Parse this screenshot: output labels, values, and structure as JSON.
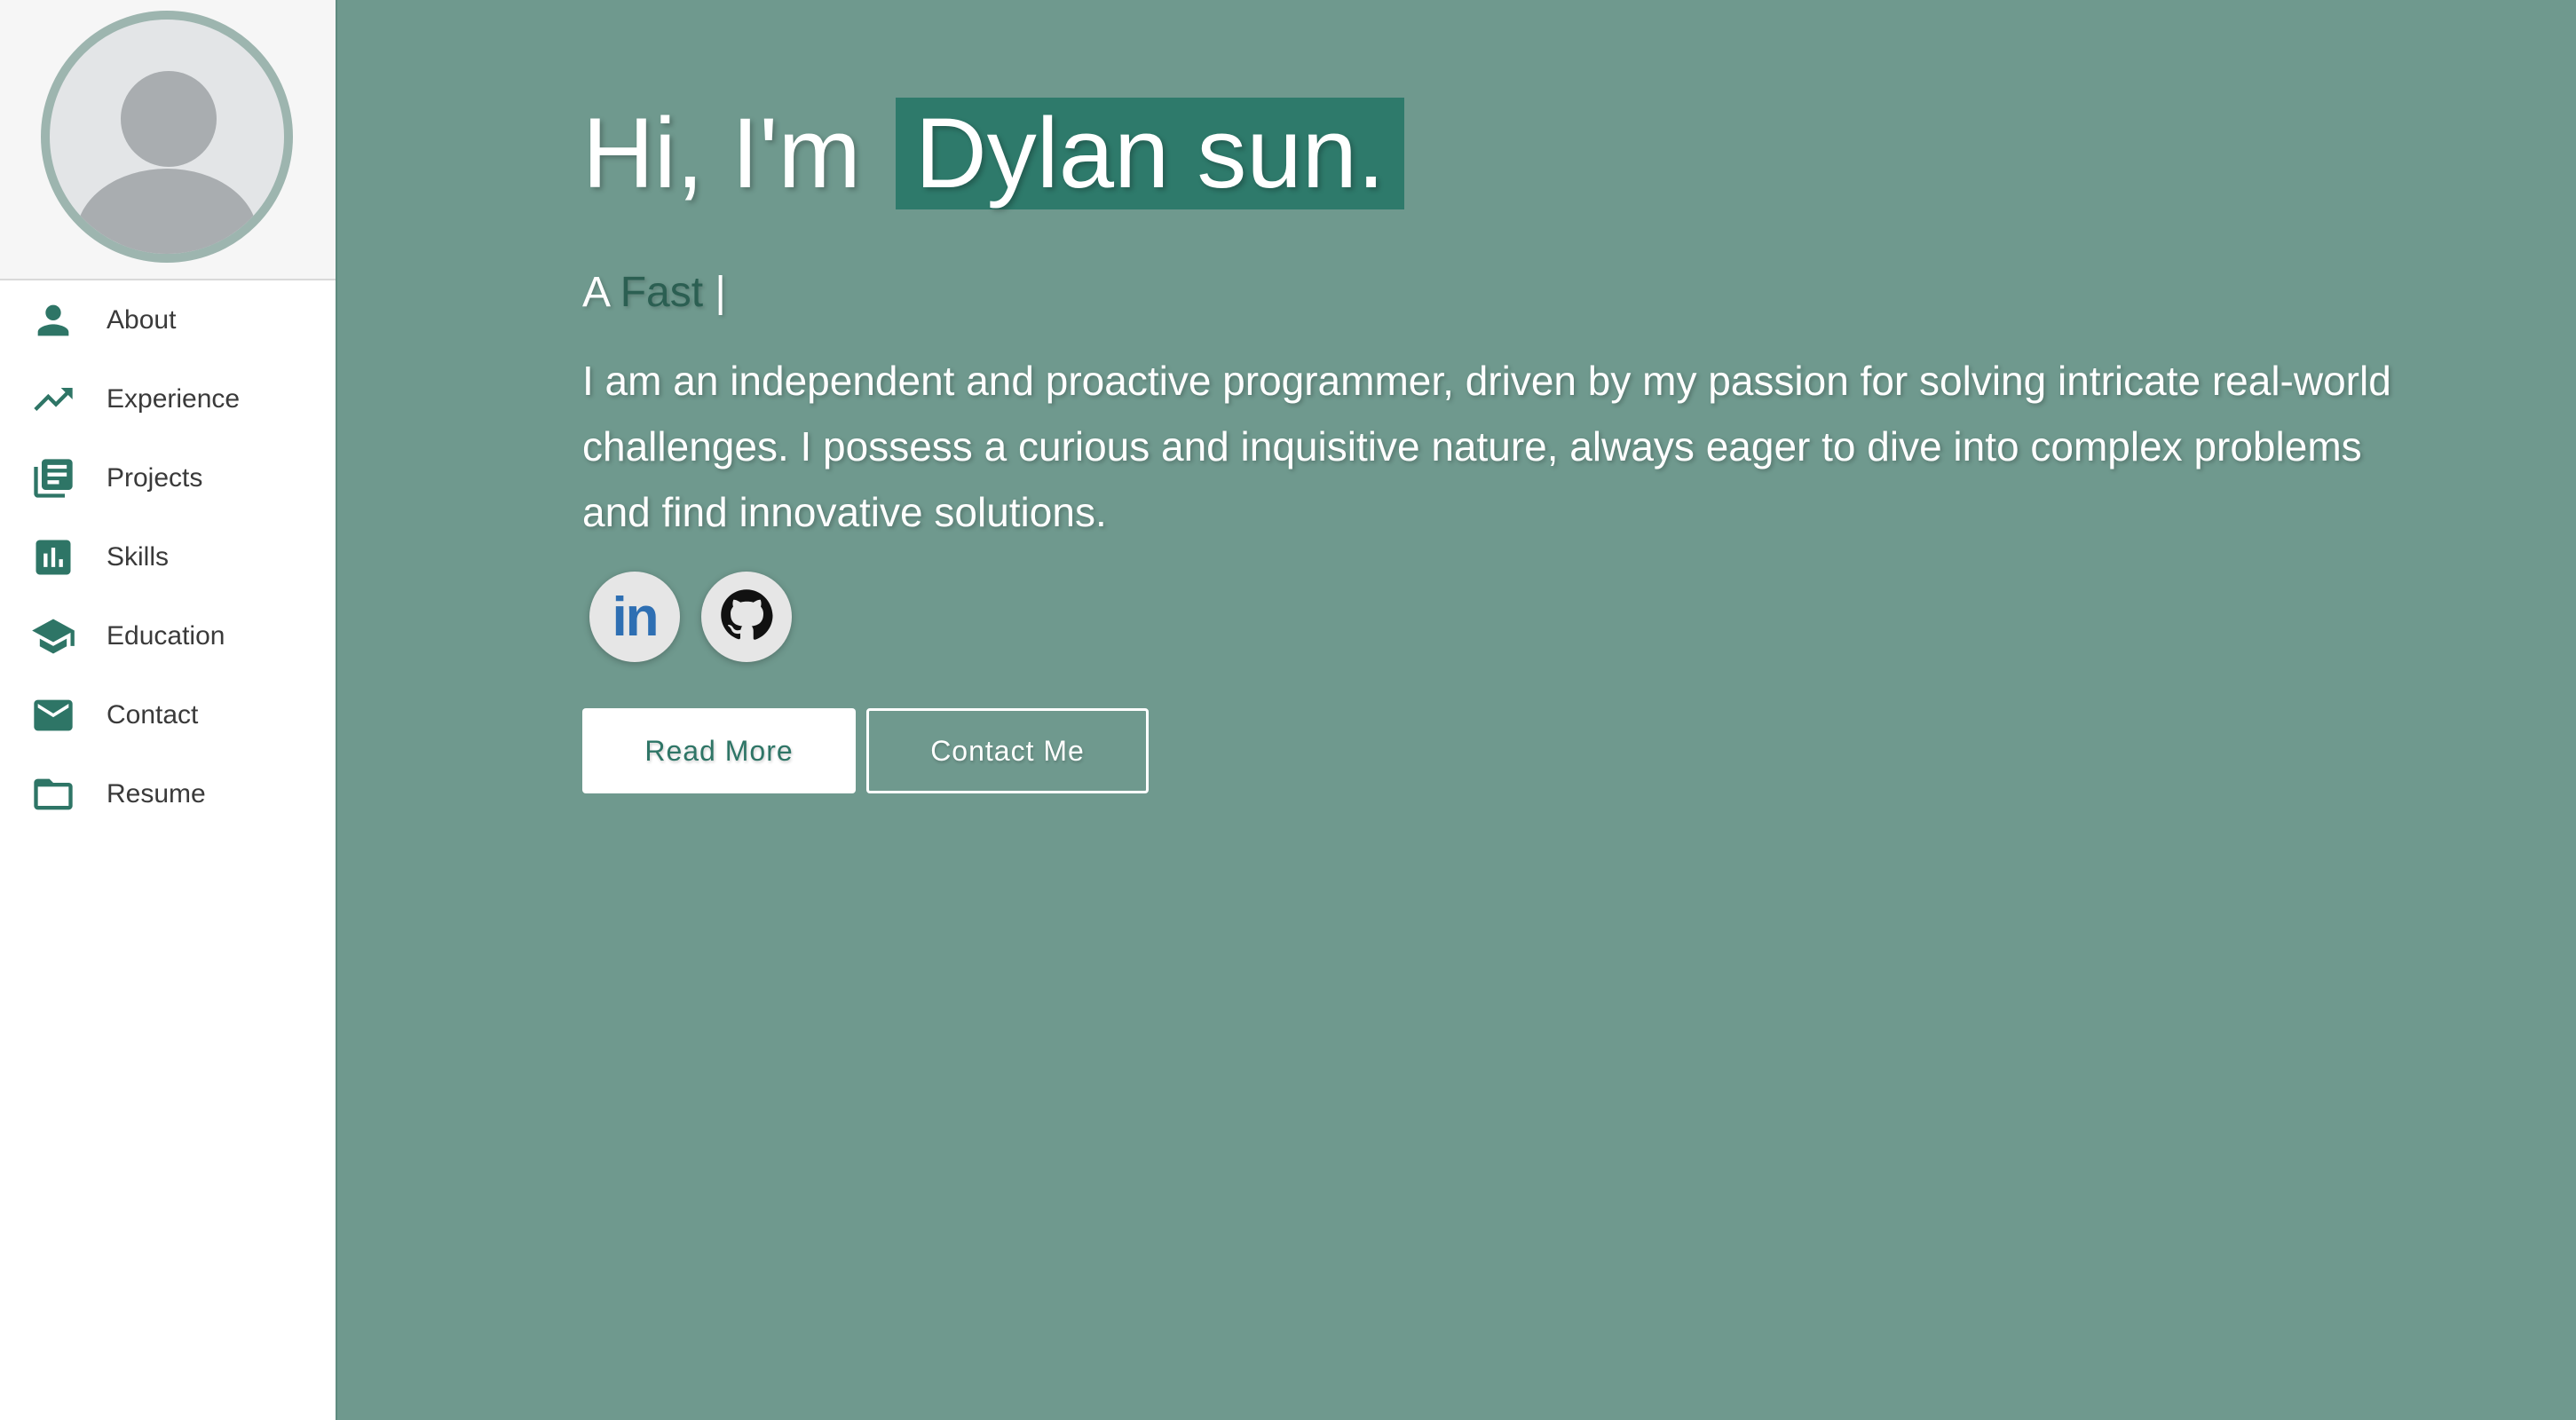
{
  "sidebar": {
    "items": [
      {
        "label": "About",
        "icon": "person-icon"
      },
      {
        "label": "Experience",
        "icon": "trending-up-icon"
      },
      {
        "label": "Projects",
        "icon": "library-books-icon"
      },
      {
        "label": "Skills",
        "icon": "bar-chart-icon"
      },
      {
        "label": "Education",
        "icon": "school-icon"
      },
      {
        "label": "Contact",
        "icon": "mail-icon"
      },
      {
        "label": "Resume",
        "icon": "folder-icon"
      }
    ]
  },
  "hero": {
    "greeting_prefix": "Hi, I'm",
    "name": "Dylan sun.",
    "typed_prefix": "A",
    "typed_word": "Fast",
    "typed_cursor": "|",
    "bio": "I am an independent and proactive programmer, driven by my passion for solving intricate real-world challenges. I possess a curious and inquisitive nature, always eager to dive into complex problems and find innovative solutions.",
    "linkedin_text": "in",
    "read_more_label": "Read More",
    "contact_label": "Contact Me"
  },
  "colors": {
    "background": "#6f998e",
    "accent": "#2e7566",
    "name_highlight": "#2e7a6b",
    "sidebar": "#ffffff"
  }
}
